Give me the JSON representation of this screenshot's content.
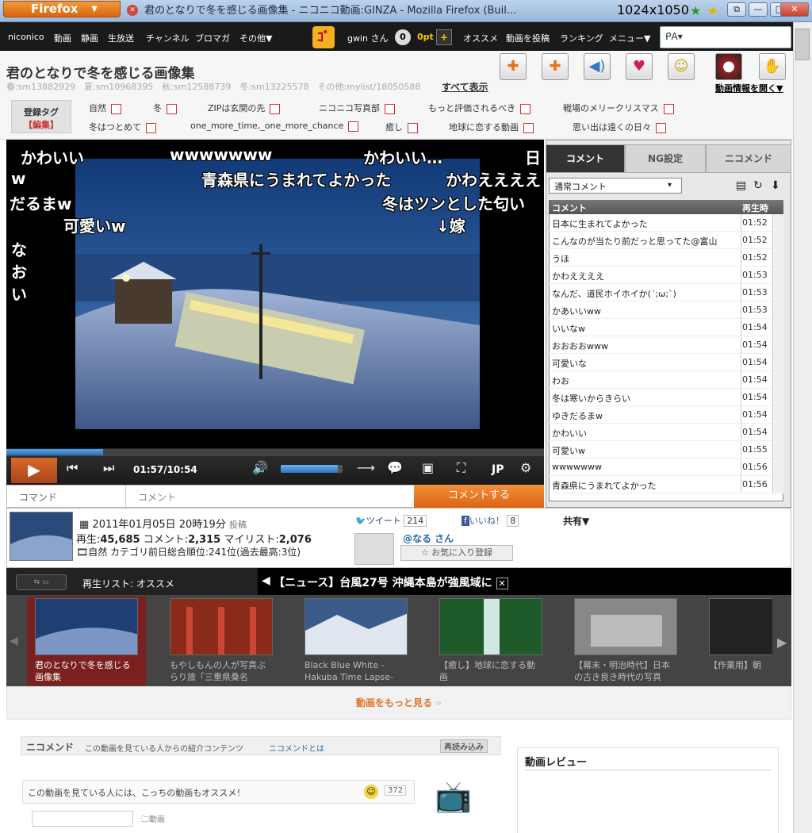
{
  "window": {
    "brand": "Firefox",
    "title": "君のとなりで冬を感じる画像集 ‐ ニコニコ動画:GINZA - Mozilla Firefox (Buil...",
    "dims": "1024x1050",
    "min": "—",
    "max": "□",
    "close": "✕",
    "restore": "⧉"
  },
  "nav": {
    "items": [
      "niconico",
      "動画",
      "静画",
      "生放送",
      "チャンネル",
      "ブロマガ",
      "その他▼"
    ],
    "user": "gwin さん",
    "badge": "0",
    "points": "0pt",
    "plus": "+",
    "right_items": [
      "オススメ",
      "動画を投稿",
      "ランキング",
      "メニュー▼"
    ],
    "search_placeholder": "ᑭA▾"
  },
  "video": {
    "title": "君のとなりで冬を感じる画像集",
    "series": "春:sm13882929　夏:sm10968395　秋:sm12588739　冬:sm13225578　その他:mylist/18050588",
    "series_all": "すべて表示",
    "info_open": "動画情報を開く▼",
    "tag_header": "登録タグ",
    "tag_edit": "【編集】",
    "tags_row1": [
      "自然",
      "冬",
      "ZIPは玄関の先",
      "ニコニコ写真部",
      "もっと評価されるべき",
      "戦場のメリークリスマス"
    ],
    "tags_row2": [
      "冬はつとめて",
      "one_more_time,_one_more_chance",
      "癒し",
      "地球に恋する動画",
      "思い出は遠くの日々"
    ]
  },
  "overlay_comments": [
    "かわいい",
    "wwwwwww",
    "かわいい…",
    "日",
    "w",
    "青森県にうまれてよかった",
    "かわええええ",
    "だるまw",
    "冬はツンとした匂い",
    "可愛いw",
    "↓嫁",
    "な",
    "お",
    "い"
  ],
  "player": {
    "time": "01:57/10:54",
    "lang": "JP",
    "cmd_label": "コマンド",
    "cm_placeholder": "コメント",
    "send": "コメントする",
    "progress": 0.18,
    "volume": 0.92
  },
  "comment_panel": {
    "tabs": [
      "コメント",
      "NG設定",
      "ニコメンド"
    ],
    "select": "通常コメント",
    "col_comment": "コメント",
    "col_time": "再生時",
    "rows": [
      {
        "text": "日本に生まれてよかった",
        "time": "01:52"
      },
      {
        "text": "こんなのが当たり前だっと思ってた@富山",
        "time": "01:52"
      },
      {
        "text": "うほ",
        "time": "01:52"
      },
      {
        "text": "かわええええ",
        "time": "01:53"
      },
      {
        "text": "なんだ、道民ホイホイか(´;ω;`)",
        "time": "01:53"
      },
      {
        "text": "かあいいww",
        "time": "01:53"
      },
      {
        "text": "いいなw",
        "time": "01:54"
      },
      {
        "text": "おおおおwww",
        "time": "01:54"
      },
      {
        "text": "可愛いな",
        "time": "01:54"
      },
      {
        "text": "わお",
        "time": "01:54"
      },
      {
        "text": "冬は寒いからきらい",
        "time": "01:54"
      },
      {
        "text": "ゆきだるまw",
        "time": "01:54"
      },
      {
        "text": "かわいい",
        "time": "01:54"
      },
      {
        "text": "可愛いw",
        "time": "01:55"
      },
      {
        "text": "wwwwwww",
        "time": "01:56"
      },
      {
        "text": "青森県にうまれてよかった",
        "time": "01:56"
      }
    ]
  },
  "stats": {
    "date": "2011年01月05日 20時19分",
    "post_label": "投稿",
    "views_label": "再生:",
    "views": "45,685",
    "comments_label": "コメント:",
    "comments": "2,315",
    "mylist_label": "マイリスト:",
    "mylist": "2,076",
    "category": "自然 カテゴリ前日総合順位:241位(過去最高:3位)",
    "tweet": "ツイート",
    "tweet_count": "214",
    "like": "いいね！",
    "like_count": "8",
    "share": "共有▼",
    "uploader": "@なる さん",
    "fav": "☆ お気に入り登録"
  },
  "playlist": {
    "label": "再生リスト: オススメ",
    "news": "【ニュース】台風27号 沖縄本島が強風域に",
    "items": [
      "君のとなりで冬を感じる画像集",
      "もやしもんの人が写真ぶらり旅「三重県桑名",
      "Black Blue White -Hakuba Time Lapse-",
      "【癒し】地球に恋する動画",
      "【幕末・明治時代】日本の古き良き時代の写真",
      "【作業用】朝"
    ],
    "more": "動画をもっと見る"
  },
  "bottom": {
    "nicomend_title": "ニコメンド",
    "nicomend_desc": "この動画を見ている人からの紹介コンテンツ",
    "nicomend_link": "ニコメンドとは",
    "reload": "再読み込み",
    "rec_text": "この動画を見ている人には、こっちの動画もオススメ！",
    "rec_count": "372",
    "review": "動画レビュー",
    "doga": "動画"
  }
}
